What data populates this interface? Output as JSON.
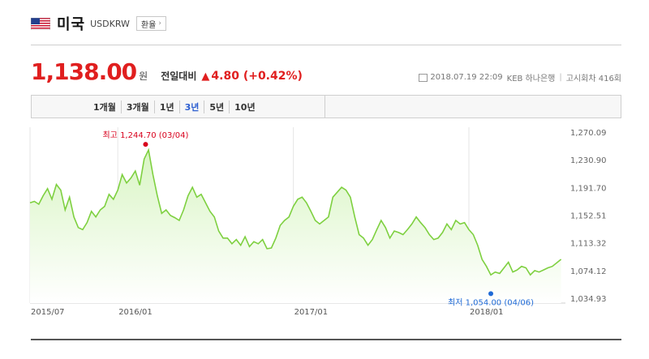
{
  "header": {
    "country": "미국",
    "code": "USDKRW",
    "rate_button": "환율"
  },
  "quote": {
    "price": "1,138.00",
    "unit": "원",
    "vs_label": "전일대비",
    "change_symbol": "▲",
    "change": "4.80",
    "change_pct": "(+0.42%)",
    "color_up": "#e01f1f"
  },
  "meta": {
    "datetime": "2018.07.19 22:09",
    "bank": "KEB 하나은행",
    "notice": "고시회차 416회"
  },
  "tabs": [
    {
      "label": "1개월",
      "active": false
    },
    {
      "label": "3개월",
      "active": false
    },
    {
      "label": "1년",
      "active": false
    },
    {
      "label": "3년",
      "active": true
    },
    {
      "label": "5년",
      "active": false
    },
    {
      "label": "10년",
      "active": false
    }
  ],
  "chart_data": {
    "type": "area",
    "y_ticks": [
      "1,270.09",
      "1,230.90",
      "1,191.70",
      "1,152.51",
      "1,113.32",
      "1,074.12",
      "1,034.93"
    ],
    "y_tick_values": [
      1270.09,
      1230.9,
      1191.7,
      1152.51,
      1113.32,
      1074.12,
      1034.93
    ],
    "ylim": [
      1034.93,
      1270.09
    ],
    "x_ticks": [
      {
        "label": "2015/07",
        "t": 0
      },
      {
        "label": "2016/01",
        "t": 6
      },
      {
        "label": "2017/01",
        "t": 18
      },
      {
        "label": "2018/01",
        "t": 30
      }
    ],
    "xlim": [
      0,
      36.6
    ],
    "series": [
      {
        "line_color": "#7ed040",
        "fill_color": "#d9f5c4",
        "t": [
          0,
          0.3,
          0.6,
          0.9,
          1.2,
          1.5,
          1.8,
          2.1,
          2.4,
          2.7,
          3.0,
          3.3,
          3.6,
          3.9,
          4.2,
          4.5,
          4.8,
          5.1,
          5.4,
          5.7,
          6.0,
          6.3,
          6.6,
          6.9,
          7.2,
          7.5,
          7.8,
          8.1,
          8.4,
          8.7,
          9.0,
          9.3,
          9.6,
          9.9,
          10.2,
          10.5,
          10.8,
          11.1,
          11.4,
          11.7,
          12.0,
          12.3,
          12.6,
          12.9,
          13.2,
          13.5,
          13.8,
          14.1,
          14.4,
          14.7,
          15.0,
          15.3,
          15.6,
          15.9,
          16.2,
          16.5,
          16.8,
          17.1,
          17.4,
          17.7,
          18.0,
          18.3,
          18.6,
          18.9,
          19.2,
          19.5,
          19.8,
          20.1,
          20.4,
          20.7,
          21.0,
          21.3,
          21.6,
          21.9,
          22.2,
          22.5,
          22.8,
          23.1,
          23.4,
          23.7,
          24.0,
          24.3,
          24.6,
          24.9,
          25.2,
          25.5,
          25.8,
          26.1,
          26.4,
          26.7,
          27.0,
          27.3,
          27.6,
          27.9,
          28.2,
          28.5,
          28.8,
          29.1,
          29.4,
          29.7,
          30.0,
          30.3,
          30.6,
          30.9,
          31.2,
          31.5,
          31.8,
          32.1,
          32.4,
          32.7,
          33.0,
          33.3,
          33.6,
          33.9,
          34.2,
          34.5,
          34.8,
          35.1,
          35.4,
          35.7,
          36.0,
          36.3
        ],
        "values": [
          1170,
          1172,
          1168,
          1180,
          1190,
          1175,
          1196,
          1188,
          1160,
          1178,
          1150,
          1135,
          1132,
          1142,
          1158,
          1150,
          1160,
          1165,
          1182,
          1175,
          1188,
          1210,
          1198,
          1205,
          1215,
          1195,
          1232,
          1244.7,
          1210,
          1180,
          1155,
          1160,
          1152,
          1149,
          1145,
          1160,
          1180,
          1192,
          1178,
          1182,
          1170,
          1158,
          1150,
          1130,
          1120,
          1120,
          1112,
          1118,
          1110,
          1122,
          1108,
          1115,
          1112,
          1118,
          1105,
          1106,
          1120,
          1138,
          1145,
          1150,
          1165,
          1175,
          1178,
          1170,
          1158,
          1145,
          1140,
          1145,
          1150,
          1178,
          1185,
          1192,
          1188,
          1178,
          1150,
          1125,
          1120,
          1110,
          1118,
          1132,
          1145,
          1135,
          1120,
          1130,
          1128,
          1125,
          1132,
          1140,
          1150,
          1142,
          1135,
          1125,
          1118,
          1120,
          1128,
          1140,
          1132,
          1145,
          1140,
          1142,
          1132,
          1125,
          1110,
          1090,
          1080,
          1068,
          1072,
          1070,
          1078,
          1086,
          1072,
          1075,
          1080,
          1078,
          1068,
          1074,
          1072,
          1075,
          1078,
          1080,
          1085,
          1090,
          1098,
          1105,
          1116,
          1118,
          1122,
          1140
        ]
      }
    ],
    "annotations": [
      {
        "label": "최고 1,244.70 (03/04)",
        "t": 7.9,
        "value": 1244.7,
        "color": "#d8001c",
        "position": "above"
      },
      {
        "label": "최저 1,054.00 (04/06)",
        "t": 31.5,
        "value": 1054.0,
        "color": "#1f6ad6",
        "position": "below"
      }
    ],
    "grid": "vertical"
  }
}
